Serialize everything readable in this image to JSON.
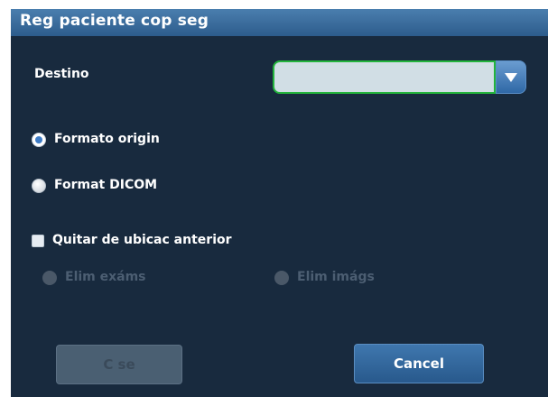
{
  "dialog": {
    "title": "Reg paciente cop seg"
  },
  "destination": {
    "label": "Destino",
    "value": ""
  },
  "format_options": [
    {
      "label": "Formato origin",
      "selected": true
    },
    {
      "label": "Format DICOM",
      "selected": false
    }
  ],
  "remove_source": {
    "label": "Quitar de ubicac anterior",
    "checked": false,
    "options": [
      {
        "label": "Elim exáms",
        "enabled": false
      },
      {
        "label": "Elim imágs",
        "enabled": false
      }
    ]
  },
  "buttons": {
    "ok_label": "C se",
    "cancel_label": "Cancel"
  },
  "colors": {
    "background": "#182a3e",
    "title_bar": "#3a6c9e",
    "accent": "#3e7cc6",
    "focus_border": "#23b43c"
  },
  "icons": {
    "dropdown": "triangle-down",
    "radio_selected": "radio-on",
    "radio_unselected": "radio-off",
    "checkbox": "checkbox-empty"
  }
}
